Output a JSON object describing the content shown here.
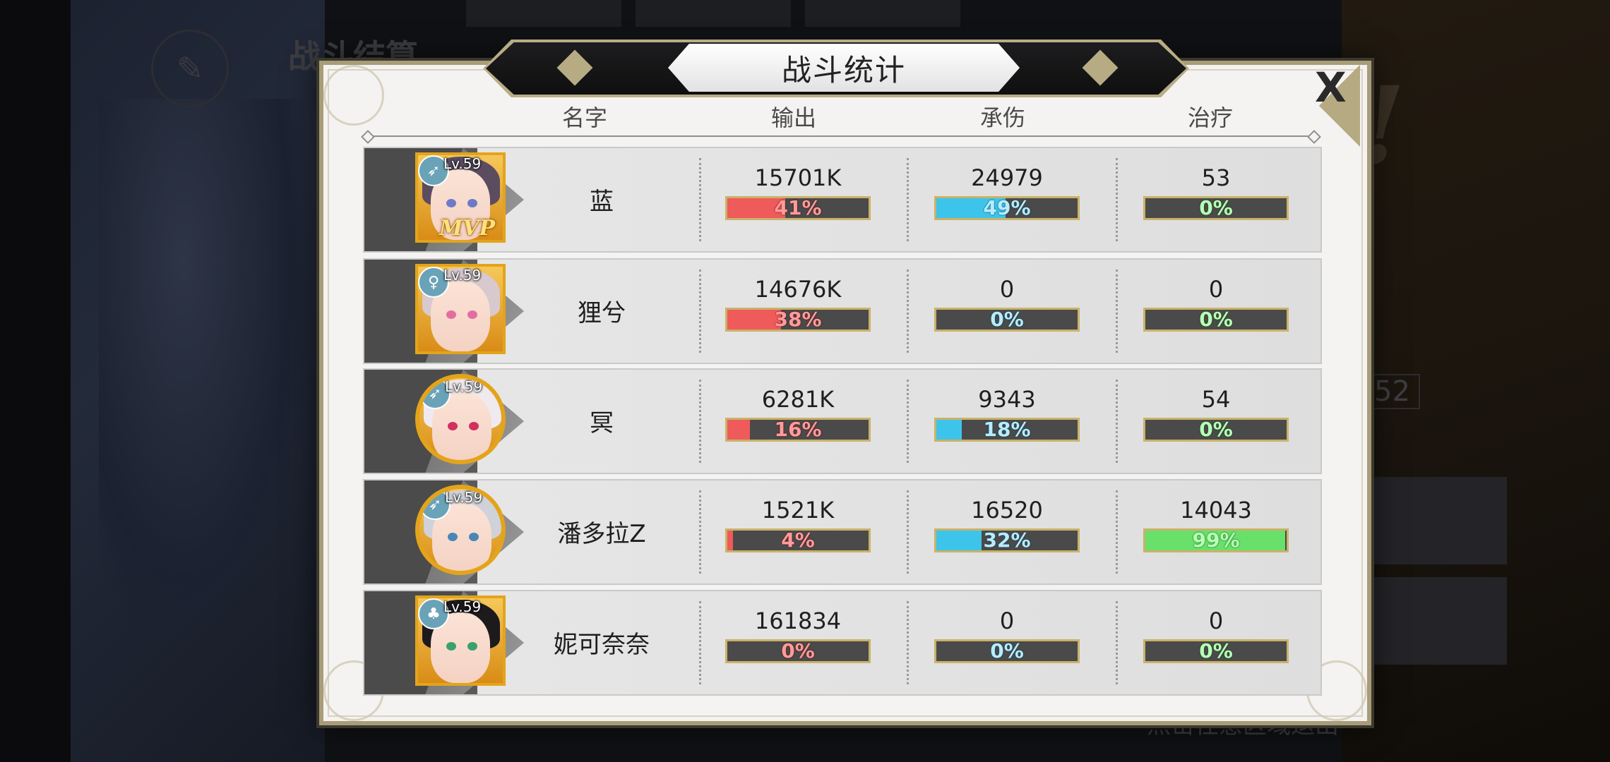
{
  "background": {
    "title": "战斗结算",
    "exit_hint": "点击任意区域退出",
    "side_number": "52",
    "victory_text": "R!"
  },
  "modal": {
    "title": "战斗统计",
    "close_label": "X",
    "columns": [
      "名字",
      "输出",
      "承伤",
      "治疗"
    ]
  },
  "colors": {
    "output_bar": "#ef5a5a",
    "damage_taken_bar": "#3dc4ea",
    "healing_bar": "#69e06a",
    "frame_gold": "#a89c79"
  },
  "rows": [
    {
      "name": "蓝",
      "level": "Lv.59",
      "class_icon": "bow-icon",
      "mvp": "MVP",
      "avatar_shape": "square",
      "hair": "#5b4c60",
      "eye": "#6e79c9",
      "output": {
        "value": "15701K",
        "pct": "41%",
        "fill": 0.41
      },
      "taken": {
        "value": "24979",
        "pct": "49%",
        "fill": 0.49
      },
      "heal": {
        "value": "53",
        "pct": "0%",
        "fill": 0.0
      }
    },
    {
      "name": "狸兮",
      "level": "Lv.59",
      "class_icon": "staff-icon",
      "mvp": "",
      "avatar_shape": "square",
      "hair": "#d8c9cf",
      "eye": "#e26ea0",
      "output": {
        "value": "14676K",
        "pct": "38%",
        "fill": 0.38
      },
      "taken": {
        "value": "0",
        "pct": "0%",
        "fill": 0.0
      },
      "heal": {
        "value": "0",
        "pct": "0%",
        "fill": 0.0
      }
    },
    {
      "name": "冥",
      "level": "Lv.59",
      "class_icon": "bow-icon",
      "mvp": "",
      "avatar_shape": "round",
      "hair": "#efeaf0",
      "eye": "#d0315f",
      "output": {
        "value": "6281K",
        "pct": "16%",
        "fill": 0.16
      },
      "taken": {
        "value": "9343",
        "pct": "18%",
        "fill": 0.18
      },
      "heal": {
        "value": "54",
        "pct": "0%",
        "fill": 0.0
      }
    },
    {
      "name": "潘多拉Z",
      "level": "Lv.59",
      "class_icon": "bow-icon",
      "mvp": "",
      "avatar_shape": "round",
      "hair": "#cfd2d8",
      "eye": "#4a86b8",
      "output": {
        "value": "1521K",
        "pct": "4%",
        "fill": 0.04
      },
      "taken": {
        "value": "16520",
        "pct": "32%",
        "fill": 0.32
      },
      "heal": {
        "value": "14043",
        "pct": "99%",
        "fill": 0.99
      }
    },
    {
      "name": "妮可奈奈",
      "level": "Lv.59",
      "class_icon": "clover-icon",
      "mvp": "",
      "avatar_shape": "square",
      "hair": "#1d1a1e",
      "eye": "#3aa06e",
      "output": {
        "value": "161834",
        "pct": "0%",
        "fill": 0.0
      },
      "taken": {
        "value": "0",
        "pct": "0%",
        "fill": 0.0
      },
      "heal": {
        "value": "0",
        "pct": "0%",
        "fill": 0.0
      }
    }
  ]
}
